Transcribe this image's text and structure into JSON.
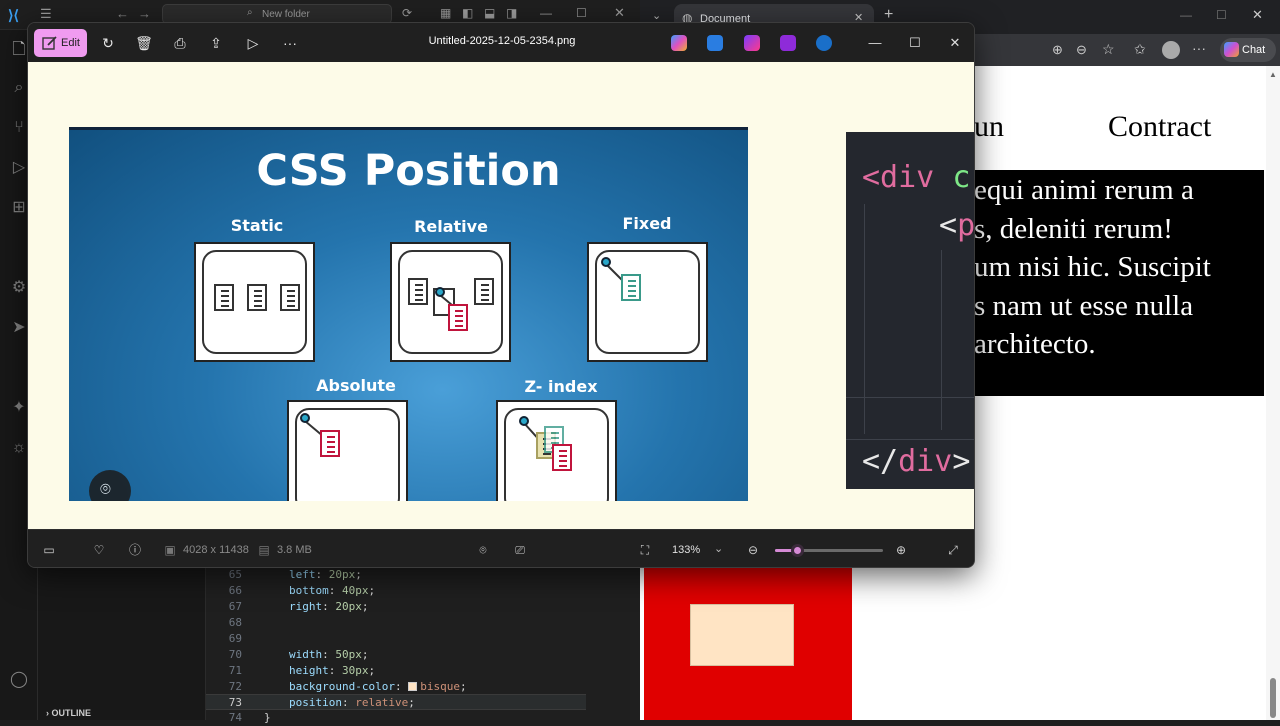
{
  "vscode": {
    "search_placeholder": "New folder",
    "outline_label": "OUTLINE",
    "code_lines": [
      {
        "n": "65",
        "prop": "left",
        "val": "20px"
      },
      {
        "n": "66",
        "prop": "bottom",
        "val": "40px"
      },
      {
        "n": "67",
        "prop": "right",
        "val": "20px"
      },
      {
        "n": "68",
        "prop": "",
        "val": ""
      },
      {
        "n": "69",
        "prop": "",
        "val": ""
      },
      {
        "n": "70",
        "prop": "width",
        "val": "50px"
      },
      {
        "n": "71",
        "prop": "height",
        "val": "30px"
      },
      {
        "n": "72",
        "prop": "background-color",
        "val": "bisque"
      },
      {
        "n": "73",
        "prop": "position",
        "val": "relative"
      },
      {
        "n": "74",
        "prop": "",
        "val": "}"
      }
    ]
  },
  "browser": {
    "tab_title": "Document",
    "chat_label": "Chat",
    "nav_partial": "un",
    "nav_contract": "Contract",
    "paragraph_lines": [
      "equi animi rerum a",
      "s, deleniti rerum!",
      "um nisi hic. Suscipit",
      "s nam ut esse nulla",
      "architecto."
    ],
    "colors": {
      "red_box": "#e00000",
      "bisque": "#ffe4c4"
    }
  },
  "photos": {
    "edit_label": "Edit",
    "filename": "Untitled-2025-12-05-2354.png",
    "dimensions": "4028 x 11438",
    "file_size": "3.8 MB",
    "zoom_level": "133%",
    "zoom_fraction": 0.2,
    "accent": "#f09bf0"
  },
  "slide": {
    "title": "CSS Position",
    "labels": {
      "static": "Static",
      "relative": "Relative",
      "fixed": "Fixed",
      "absolute": "Absolute",
      "zindex": "Z- index"
    }
  },
  "code_panel": {
    "open_tag": "<div",
    "open_attr": "c",
    "p_tag_lt": "<",
    "p_tag": "p",
    "close_tag_lt": "</",
    "close_tag": "div",
    "close_tag_gt": ">"
  }
}
